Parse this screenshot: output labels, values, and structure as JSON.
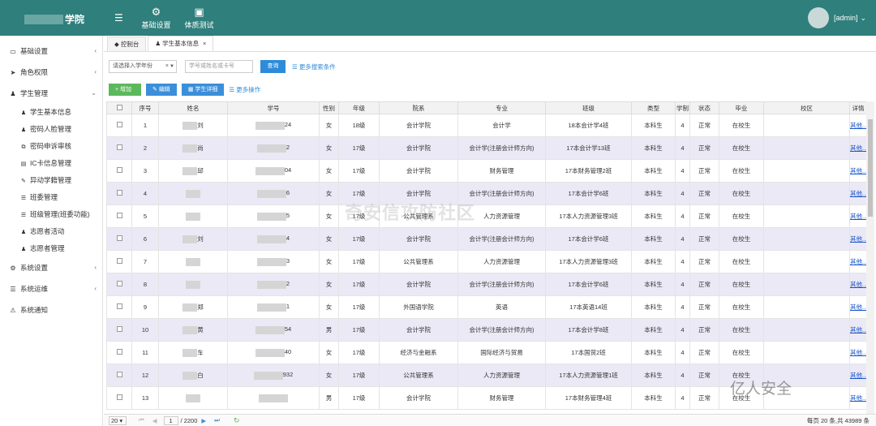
{
  "header": {
    "logo_suffix": "学院",
    "menu_icon": "menu-icon",
    "nav": [
      {
        "label": "基础设置",
        "icon": "gear-icon"
      },
      {
        "label": "体质测试",
        "icon": "sitemap-icon"
      }
    ],
    "user": "[admin]"
  },
  "sidebar": {
    "items": [
      {
        "label": "基础设置",
        "icon": "monitor-icon"
      },
      {
        "label": "角色权限",
        "icon": "send-icon"
      },
      {
        "label": "学生管理",
        "icon": "users-icon"
      },
      {
        "label": "系统设置",
        "icon": "cogs-icon"
      },
      {
        "label": "系统运维",
        "icon": "list-icon"
      },
      {
        "label": "系统通知",
        "icon": "bell-icon"
      }
    ],
    "sub_items": [
      {
        "label": "学生基本信息",
        "icon": "user-icon"
      },
      {
        "label": "密码人脸管理",
        "icon": "user-icon"
      },
      {
        "label": "密码申诉审核",
        "icon": "copy-icon"
      },
      {
        "label": "IC卡信息管理",
        "icon": "card-icon"
      },
      {
        "label": "异动学籍管理",
        "icon": "edit-icon"
      },
      {
        "label": "班委管理",
        "icon": "list-icon"
      },
      {
        "label": "班级管理(班委功能)",
        "icon": "list-icon"
      },
      {
        "label": "志愿者活动",
        "icon": "users-icon"
      },
      {
        "label": "志愿者管理",
        "icon": "user-plus-icon"
      }
    ]
  },
  "tabs": [
    {
      "label": "控制台"
    },
    {
      "label": "学生基本信息"
    }
  ],
  "search": {
    "year_placeholder": "请选择入学年份",
    "keyword_placeholder": "学号或姓名或卡号",
    "query_label": "查询",
    "more_label": "更多搜索条件"
  },
  "actions": {
    "add": "+ 增加",
    "edit": "编辑",
    "detail": "学生详细",
    "more": "更多操作"
  },
  "columns": [
    "序号",
    "姓名",
    "学号",
    "性别",
    "年级",
    "院系",
    "专业",
    "班级",
    "类型",
    "学制",
    "状态",
    "毕业",
    "校区",
    "详情"
  ],
  "rows": [
    {
      "no": "1",
      "name": "刘",
      "sid": "24",
      "sex": "女",
      "grade": "18级",
      "dept": "会计学院",
      "major": "会计学",
      "cls": "18本会计学4班",
      "type": "本科生",
      "len": "4",
      "status": "正常",
      "grad": "在校生",
      "campus": "",
      "detail": "其他..."
    },
    {
      "no": "2",
      "name": "尚",
      "sid": "2",
      "sex": "女",
      "grade": "17级",
      "dept": "会计学院",
      "major": "会计学(注册会计师方向)",
      "cls": "17本会计学13班",
      "type": "本科生",
      "len": "4",
      "status": "正常",
      "grad": "在校生",
      "campus": "",
      "detail": "其他..."
    },
    {
      "no": "3",
      "name": "邱",
      "sid": "04",
      "sex": "女",
      "grade": "17级",
      "dept": "会计学院",
      "major": "财务管理",
      "cls": "17本财务管理2班",
      "type": "本科生",
      "len": "4",
      "status": "正常",
      "grad": "在校生",
      "campus": "",
      "detail": "其他..."
    },
    {
      "no": "4",
      "name": "",
      "sid": "6",
      "sex": "女",
      "grade": "17级",
      "dept": "会计学院",
      "major": "会计学(注册会计师方向)",
      "cls": "17本会计学6班",
      "type": "本科生",
      "len": "4",
      "status": "正常",
      "grad": "在校生",
      "campus": "",
      "detail": "其他..."
    },
    {
      "no": "5",
      "name": "",
      "sid": "5",
      "sex": "女",
      "grade": "17级",
      "dept": "公共管理系",
      "major": "人力资源管理",
      "cls": "17本人力资源管理3班",
      "type": "本科生",
      "len": "4",
      "status": "正常",
      "grad": "在校生",
      "campus": "",
      "detail": "其他..."
    },
    {
      "no": "6",
      "name": "刘",
      "sid": "4",
      "sex": "女",
      "grade": "17级",
      "dept": "会计学院",
      "major": "会计学(注册会计师方向)",
      "cls": "17本会计学6班",
      "type": "本科生",
      "len": "4",
      "status": "正常",
      "grad": "在校生",
      "campus": "",
      "detail": "其他..."
    },
    {
      "no": "7",
      "name": "",
      "sid": "3",
      "sex": "女",
      "grade": "17级",
      "dept": "公共管理系",
      "major": "人力资源管理",
      "cls": "17本人力资源管理3班",
      "type": "本科生",
      "len": "4",
      "status": "正常",
      "grad": "在校生",
      "campus": "",
      "detail": "其他..."
    },
    {
      "no": "8",
      "name": "",
      "sid": "2",
      "sex": "女",
      "grade": "17级",
      "dept": "会计学院",
      "major": "会计学(注册会计师方向)",
      "cls": "17本会计学6班",
      "type": "本科生",
      "len": "4",
      "status": "正常",
      "grad": "在校生",
      "campus": "",
      "detail": "其他..."
    },
    {
      "no": "9",
      "name": "郑",
      "sid": "1",
      "sex": "女",
      "grade": "17级",
      "dept": "外国语学院",
      "major": "英语",
      "cls": "17本英语14班",
      "type": "本科生",
      "len": "4",
      "status": "正常",
      "grad": "在校生",
      "campus": "",
      "detail": "其他..."
    },
    {
      "no": "10",
      "name": "黄",
      "sid": "54",
      "sex": "男",
      "grade": "17级",
      "dept": "会计学院",
      "major": "会计学(注册会计师方向)",
      "cls": "17本会计学8班",
      "type": "本科生",
      "len": "4",
      "status": "正常",
      "grad": "在校生",
      "campus": "",
      "detail": "其他..."
    },
    {
      "no": "11",
      "name": "车",
      "sid": "40",
      "sex": "女",
      "grade": "17级",
      "dept": "经济与金融系",
      "major": "国际经济与贸易",
      "cls": "17本国贸2班",
      "type": "本科生",
      "len": "4",
      "status": "正常",
      "grad": "在校生",
      "campus": "",
      "detail": "其他..."
    },
    {
      "no": "12",
      "name": "白",
      "sid": "932",
      "sex": "女",
      "grade": "17级",
      "dept": "公共管理系",
      "major": "人力资源管理",
      "cls": "17本人力资源管理1班",
      "type": "本科生",
      "len": "4",
      "status": "正常",
      "grad": "在校生",
      "campus": "",
      "detail": "其他..."
    },
    {
      "no": "13",
      "name": "",
      "sid": "",
      "sex": "男",
      "grade": "17级",
      "dept": "会计学院",
      "major": "财务管理",
      "cls": "17本财务管理4班",
      "type": "本科生",
      "len": "4",
      "status": "正常",
      "grad": "在校生",
      "campus": "",
      "detail": "其他..."
    }
  ],
  "pager": {
    "page_size": "20",
    "page": "1",
    "total_pages": "/ 2200",
    "info": "每页 20 条,共 43989 条"
  },
  "watermark": "奇安信攻防社区",
  "watermark2": "亿人安全"
}
